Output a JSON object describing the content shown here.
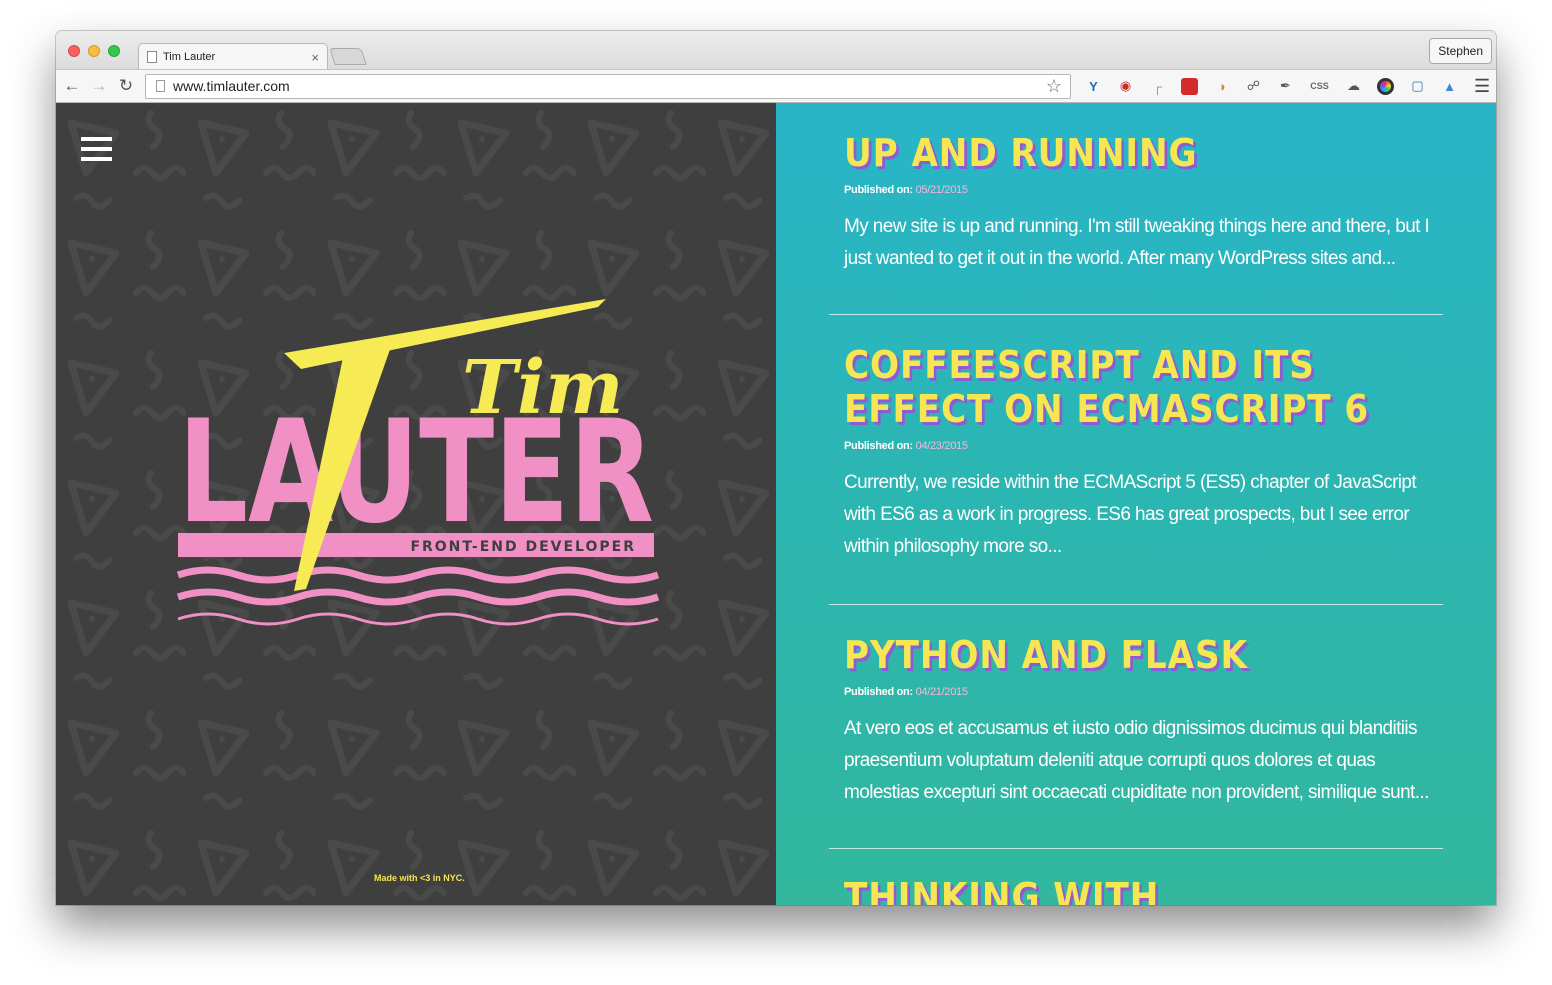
{
  "browser": {
    "tab_title": "Tim Lauter",
    "tab_close": "×",
    "profile_name": "Stephen",
    "url": "www.timlauter.com",
    "ext_css_label": "CSS"
  },
  "colors": {
    "left_bg": "#3f3f3f",
    "right_bg": "#2cb6ad",
    "title_yellow": "#f6e653",
    "title_shadow": "#8e5bd5",
    "logo_pink": "#f190c4",
    "date_pink": "#f7b7dd"
  },
  "sidebar": {
    "logo": {
      "first_name": "Tim",
      "last_name": "LAUTER",
      "tagline": "FRONT-END DEVELOPER"
    },
    "footer": "Made with <3 in NYC."
  },
  "posts": [
    {
      "title": "UP AND RUNNING",
      "meta_label": "Published on:",
      "date": "05/21/2015",
      "excerpt": "My new site is up and running. I'm still tweaking things here and there, but I just wanted to get it out in the world. After many WordPress sites and..."
    },
    {
      "title": "COFFEESCRIPT AND ITS EFFECT ON ECMASCRIPT 6",
      "meta_label": "Published on:",
      "date": "04/23/2015",
      "excerpt": "Currently, we reside within the ECMAScript 5 (ES5) chapter of JavaScript with ES6 as a work in progress. ES6 has great prospects, but I see error within philosophy more so..."
    },
    {
      "title": "PYTHON AND FLASK",
      "meta_label": "Published on:",
      "date": "04/21/2015",
      "excerpt": "At vero eos et accusamus et iusto odio dignissimos ducimus qui blanditiis praesentium voluptatum deleniti atque corrupti quos dolores et quas molestias excepturi sint occaecati cupiditate non provident, similique sunt..."
    },
    {
      "title": "THINKING WITH JAVASCRIPT"
    }
  ]
}
